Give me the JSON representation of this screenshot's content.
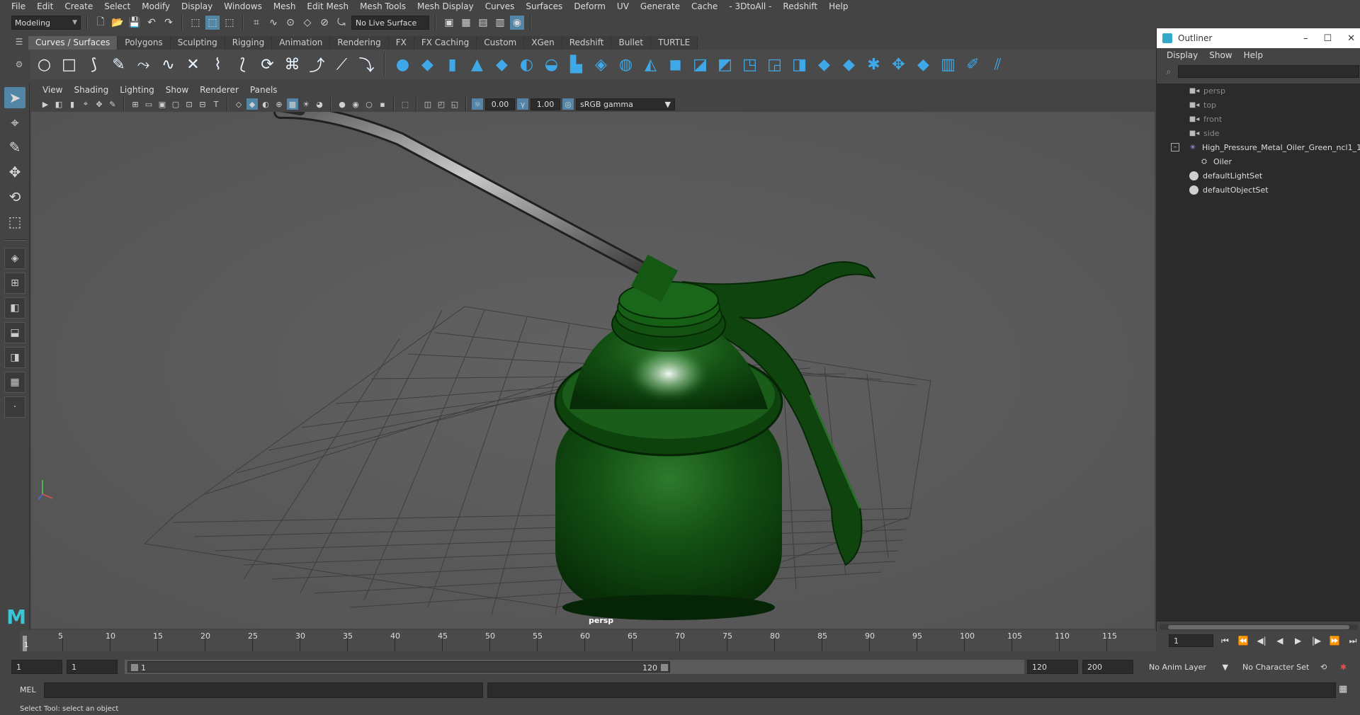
{
  "menubar": {
    "items": [
      "File",
      "Edit",
      "Create",
      "Select",
      "Modify",
      "Display",
      "Windows",
      "Mesh",
      "Edit Mesh",
      "Mesh Tools",
      "Mesh Display",
      "Curves",
      "Surfaces",
      "Deform",
      "UV",
      "Generate",
      "Cache",
      "- 3DtoAll -",
      "Redshift",
      "Help"
    ]
  },
  "statusline": {
    "menuset": "Modeling",
    "live_surface": "No Live Surface"
  },
  "shelf": {
    "tabs": [
      "Curves / Surfaces",
      "Polygons",
      "Sculpting",
      "Rigging",
      "Animation",
      "Rendering",
      "FX",
      "FX Caching",
      "Custom",
      "XGen",
      "Redshift",
      "Bullet",
      "TURTLE"
    ],
    "active_tab": "Curves / Surfaces"
  },
  "panel": {
    "menus": [
      "View",
      "Shading",
      "Lighting",
      "Show",
      "Renderer",
      "Panels"
    ],
    "exposure": "0.00",
    "gamma": "1.00",
    "colorspace": "sRGB gamma",
    "camera_label": "persp"
  },
  "outliner": {
    "title": "Outliner",
    "menus": [
      "Display",
      "Show",
      "Help"
    ],
    "cameras": [
      "persp",
      "top",
      "front",
      "side"
    ],
    "group": "High_Pressure_Metal_Oiler_Green_ncl1_1",
    "child": "Oiler",
    "sets": [
      "defaultLightSet",
      "defaultObjectSet"
    ]
  },
  "timeline": {
    "ticks": [
      "5",
      "10",
      "15",
      "20",
      "25",
      "30",
      "35",
      "40",
      "45",
      "50",
      "55",
      "60",
      "65",
      "70",
      "75",
      "80",
      "85",
      "90",
      "95",
      "100",
      "105",
      "110",
      "115"
    ],
    "current_frame_marker": "1",
    "current_frame_field": "1"
  },
  "range": {
    "start_field": "1",
    "playback_start_field": "1",
    "slider_start": "1",
    "slider_end": "120",
    "playback_end_field": "120",
    "end_field": "200",
    "anim_layer": "No Anim Layer",
    "character_set": "No Character Set"
  },
  "commandline": {
    "label": "MEL"
  },
  "helpline": {
    "text": "Select Tool: select an object"
  }
}
